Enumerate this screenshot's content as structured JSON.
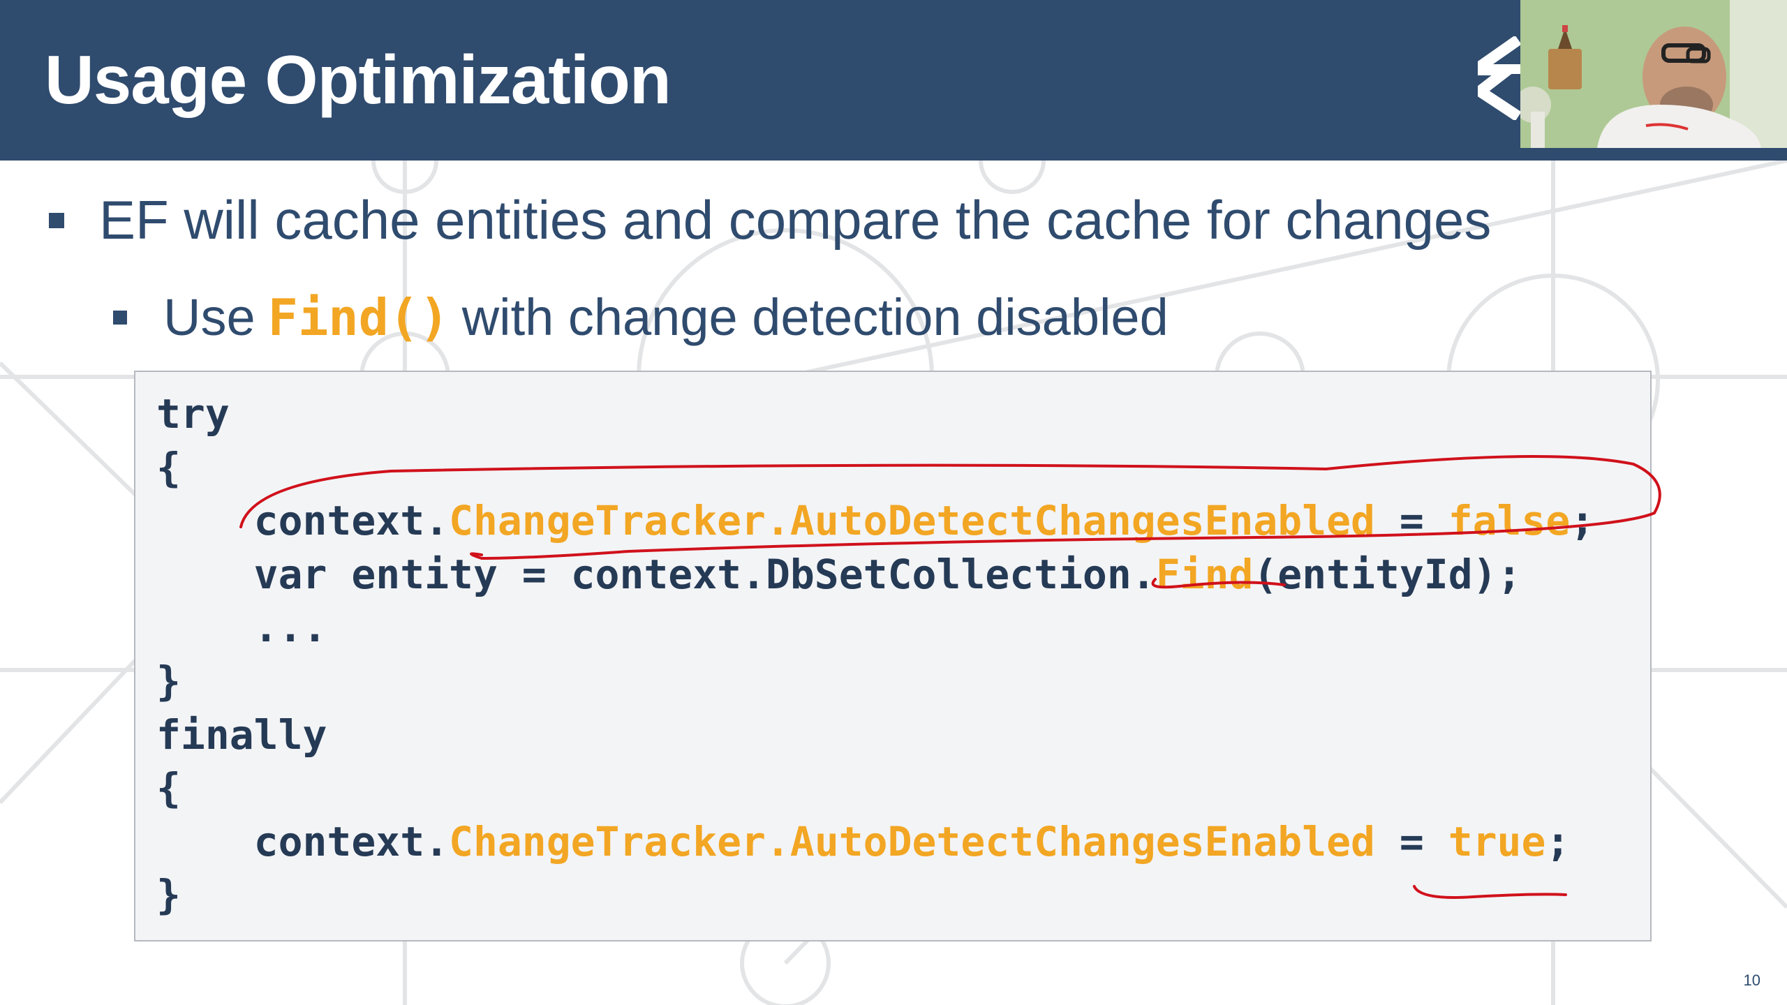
{
  "slide": {
    "title": "Usage Optimization",
    "page_number": "10",
    "colors": {
      "header_bg": "#2f4b6e",
      "accent_orange": "#f2a623",
      "code_text": "#253a55",
      "annotation_red": "#d0111b"
    }
  },
  "bullets": {
    "level1": "EF will cache entities and compare the cache for changes",
    "level2_prefix": "Use",
    "level2_code": "Find()",
    "level2_suffix": "with change detection disabled"
  },
  "code": {
    "l1": "try",
    "l2": "{",
    "l3_a": "    context.",
    "l3_b": "ChangeTracker.AutoDetectChangesEnabled",
    "l3_c": " = ",
    "l3_d": "false",
    "l3_e": ";",
    "l4_a": "    var entity = context.DbSetCollection.",
    "l4_b": "Find",
    "l4_c": "(entityId);",
    "l5": "    ...",
    "l6": "}",
    "l7": "finally",
    "l8": "{",
    "l9_a": "    context.",
    "l9_b": "ChangeTracker.AutoDetectChangesEnabled",
    "l9_c": " = ",
    "l9_d": "true",
    "l9_e": ";",
    "l10": "}"
  },
  "icons": {
    "logo": "logo-icon",
    "webcam": "presenter-webcam"
  }
}
